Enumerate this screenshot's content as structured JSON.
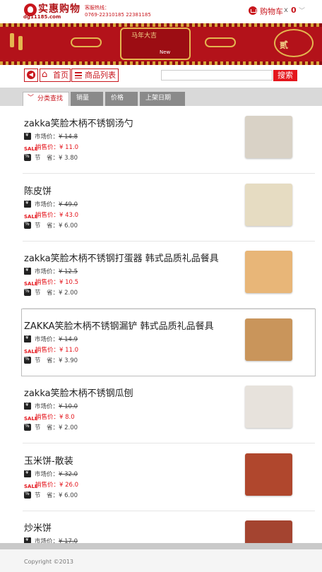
{
  "header": {
    "logo_text": "实惠购物",
    "logo_url_text": "dg11185.com",
    "hotline_label": "客服热线：",
    "hotline_numbers": "0769-22310185 22381185",
    "cart_label": "购物车",
    "cart_x": "x",
    "cart_count": "0"
  },
  "banner": {
    "center_text": "马年大吉",
    "new_text": "New",
    "right_text": "贰"
  },
  "nav": {
    "home_label": "首页",
    "list_label": "商品列表",
    "search_placeholder": "",
    "search_label": "搜索"
  },
  "filters": {
    "category": "分类查找",
    "sales": "销量",
    "price": "价格",
    "date": "上架日期"
  },
  "labels": {
    "market": "市场价：",
    "sell": "销售价：",
    "save": "节　省：",
    "sale_tag": "SALE"
  },
  "products": [
    {
      "title": "zakka笑脸木柄不锈钢汤勺",
      "market": "¥ 14.8",
      "sell": "¥ 11.0",
      "save": "¥ 3.80",
      "img_color": "#d9d2c6"
    },
    {
      "title": "陈皮饼",
      "market": "¥ 49.0",
      "sell": "¥ 43.0",
      "save": "¥ 6.00",
      "img_color": "#e6dcc2"
    },
    {
      "title": "zakka笑脸木柄不锈钢打蛋器 韩式品质礼品餐具",
      "market": "¥ 12.5",
      "sell": "¥ 10.5",
      "save": "¥ 2.00",
      "img_color": "#e8b678"
    },
    {
      "title": "ZAKKA笑脸木柄不锈钢漏铲 韩式品质礼品餐具",
      "market": "¥ 14.9",
      "sell": "¥ 11.0",
      "save": "¥ 3.90",
      "img_color": "#c9955b"
    },
    {
      "title": "zakka笑脸木柄不锈钢瓜刨",
      "market": "¥ 10.0",
      "sell": "¥ 8.0",
      "save": "¥ 2.00",
      "img_color": "#e7e2dc"
    },
    {
      "title": "玉米饼-散装",
      "market": "¥ 32.0",
      "sell": "¥ 26.0",
      "save": "¥ 6.00",
      "img_color": "#b0472d"
    },
    {
      "title": "炒米饼",
      "market": "¥ 17.0",
      "sell": "",
      "save": "",
      "img_color": "#a44430"
    }
  ],
  "footer": {
    "copyright": "Copyright ©2013"
  }
}
